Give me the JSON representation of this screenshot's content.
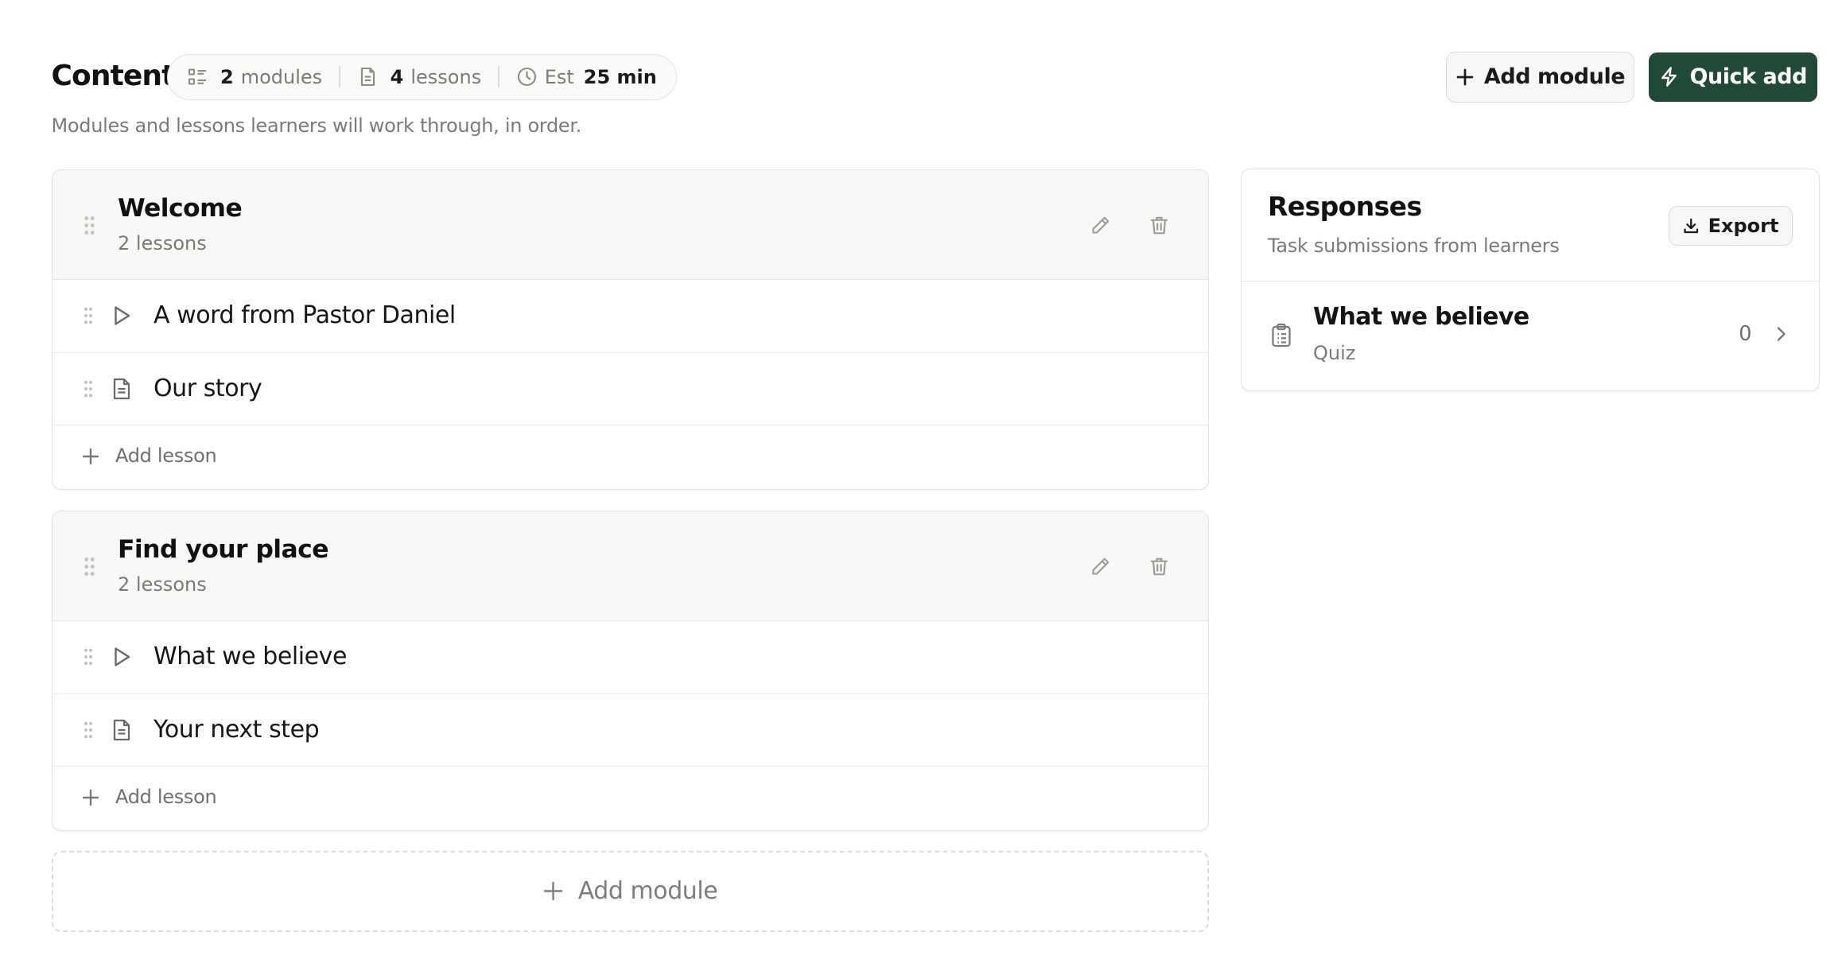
{
  "header": {
    "title": "Content",
    "stats": {
      "modules_count": "2",
      "modules_label": "modules",
      "lessons_count": "4",
      "lessons_label": "lessons",
      "est_label": "Est",
      "est_value": "25 min"
    },
    "add_module_label": "Add module",
    "quick_add_label": "Quick add",
    "subtitle": "Modules and lessons learners will work through, in order."
  },
  "modules": [
    {
      "title": "Welcome",
      "count": "2 lessons",
      "lessons": [
        {
          "title": "A word from Pastor Daniel",
          "type": "video"
        },
        {
          "title": "Our story",
          "type": "document"
        }
      ],
      "add_lesson_label": "Add lesson"
    },
    {
      "title": "Find your place",
      "count": "2 lessons",
      "lessons": [
        {
          "title": "What we believe",
          "type": "video"
        },
        {
          "title": "Your next step",
          "type": "document"
        }
      ],
      "add_lesson_label": "Add lesson"
    }
  ],
  "add_module_bottom_label": "Add module",
  "responses": {
    "title": "Responses",
    "subtitle": "Task submissions from learners",
    "export_label": "Export",
    "items": [
      {
        "name": "What we believe",
        "kind": "Quiz",
        "count": "0"
      }
    ]
  },
  "colors": {
    "primary": "#1f4a37",
    "border": "#e3e3e1",
    "muted_text": "#7a7a77",
    "header_bg": "#f8f8f7"
  },
  "icons": {
    "modules": "list-icon",
    "lessons": "document-icon",
    "time": "clock-icon",
    "quick_add": "lightning-icon",
    "edit": "pencil-icon",
    "delete": "trash-icon",
    "video": "play-icon",
    "export": "download-icon",
    "quiz": "clipboard-icon"
  }
}
